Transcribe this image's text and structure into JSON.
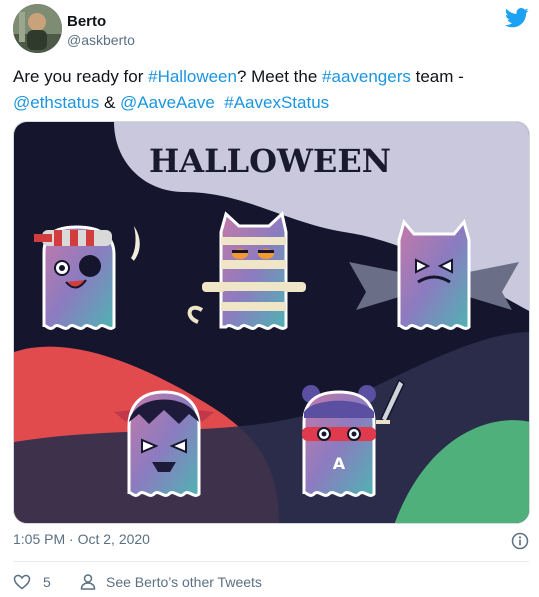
{
  "author": {
    "display_name": "Berto",
    "handle": "@askberto"
  },
  "tweet": {
    "text_parts": [
      {
        "text": "Are you ready for ",
        "link": false
      },
      {
        "text": "#Halloween",
        "link": true
      },
      {
        "text": "? Meet the ",
        "link": false
      },
      {
        "text": "#aavengers",
        "link": true
      },
      {
        "text": " team -",
        "link": false
      },
      {
        "text": "@ethstatus",
        "link": true
      },
      {
        "text": " & ",
        "link": false
      },
      {
        "text": "@AaveAave",
        "link": true
      },
      {
        "text": "  ",
        "link": false
      },
      {
        "text": "#AavexStatus",
        "link": true
      }
    ],
    "t1": "Are you ready for ",
    "l1": "#Halloween",
    "t2": "? Meet the ",
    "l2": "#aavengers",
    "t3": " team -",
    "l3": "@ethstatus",
    "t4": " & ",
    "l4": "@AaveAave",
    "l5": "#AavexStatus"
  },
  "media": {
    "title": "HALLOWEEN",
    "badge_letter": "A"
  },
  "meta": {
    "timestamp": "1:05 PM · Oct 2, 2020"
  },
  "actions": {
    "like_count": "5",
    "other_tweets_label": "See Berto’s other Tweets"
  },
  "colors": {
    "link": "#1b95e0",
    "muted": "#5b7083",
    "twitter_blue": "#1da1f2"
  },
  "icons": [
    "twitter-bird-icon",
    "info-icon",
    "heart-icon",
    "person-icon"
  ]
}
